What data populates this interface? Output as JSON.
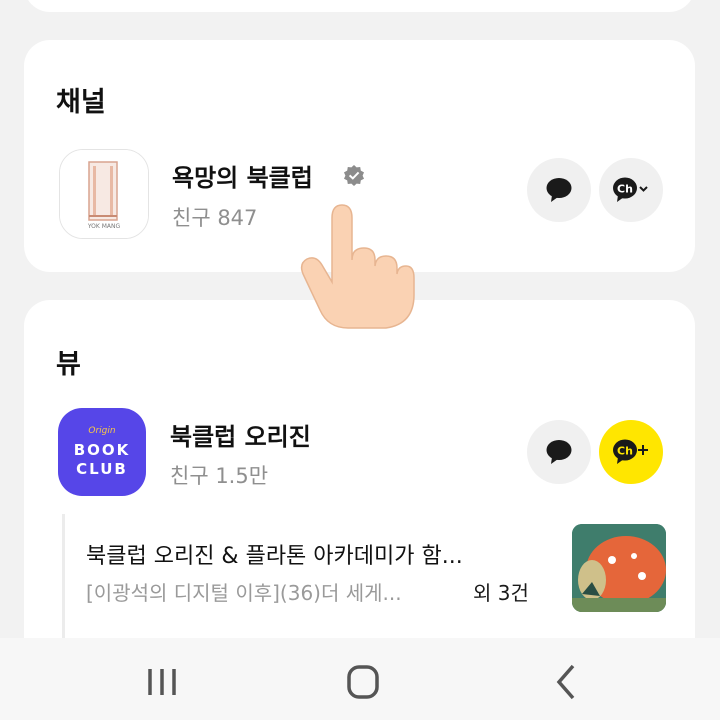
{
  "channel_section": {
    "title": "채널",
    "item": {
      "name": "욕망의 북클럽",
      "verified_icon": "verified-check-icon",
      "friends": "친구 847",
      "logo_caption": "YOK MANG",
      "chat_icon": "chat-bubble-icon",
      "channel_icon": "channel-dropdown-icon"
    }
  },
  "view_section": {
    "title": "뷰",
    "item": {
      "name": "북클럽 오리진",
      "friends": "친구 1.5만",
      "logo": {
        "line1": "Origin",
        "line2": "BOOK",
        "line3": "CLUB"
      },
      "chat_icon": "chat-bubble-icon",
      "channel_add_icon": "channel-add-icon"
    },
    "post": {
      "title": "북클럽 오리진 & 플라톤 아카데미가 함...",
      "subtitle": "[이광석의 디지털 이후](36)더 세게...",
      "count": "외 3건"
    }
  },
  "colors": {
    "accent_yellow": "#ffe600",
    "club_purple": "#5646e8"
  },
  "navbar": {
    "recent_icon": "recent-apps-icon",
    "home_icon": "home-icon",
    "back_icon": "back-icon"
  }
}
